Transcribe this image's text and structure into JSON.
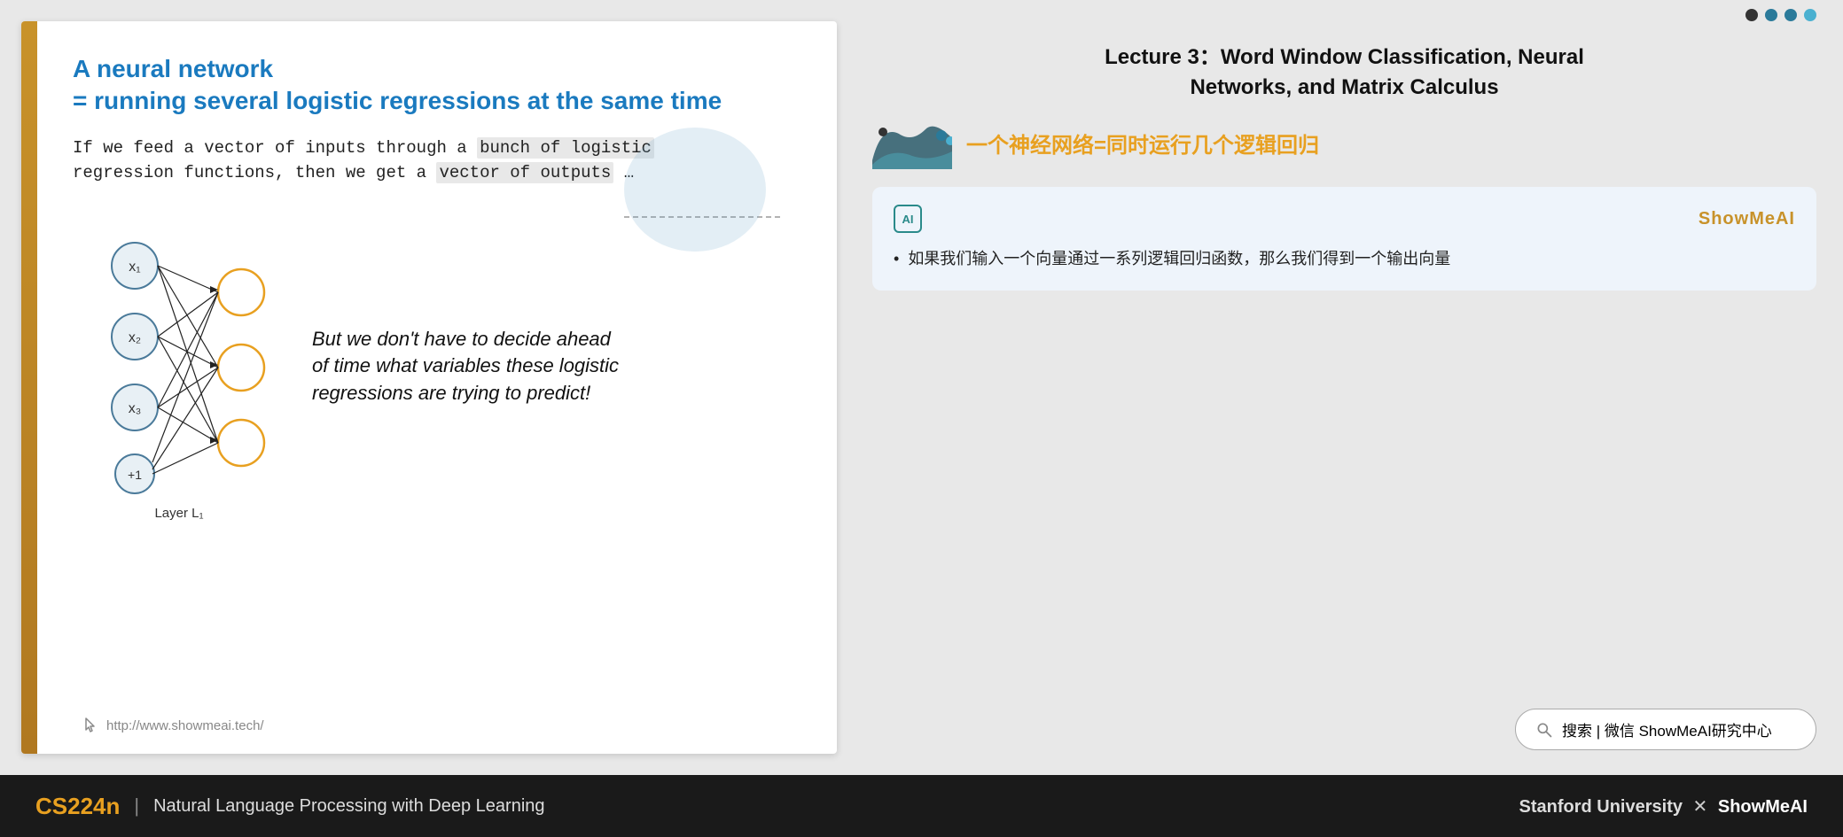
{
  "slide": {
    "title_line1": "A neural network",
    "title_line2": "= running several logistic regressions at the same time",
    "body_text": "If we feed a vector of inputs through a bunch of logistic regression functions, then we get a vector of outputs …",
    "italic_text": "But we don't have to decide ahead of time what variables these logistic regressions are trying to predict!",
    "layer_label": "Layer L₁",
    "url": "http://www.showmeai.tech/",
    "nodes_input": [
      "x₁",
      "x₂",
      "x₃",
      "+1"
    ]
  },
  "right": {
    "lecture_title_line1": "Lecture 3：Word Window Classification, Neural",
    "lecture_title_line2": "Networks, and Matrix Calculus",
    "chinese_title": "一个神经网络=同时运行几个逻辑回归",
    "card_brand": "ShowMeAI",
    "card_body_bullet": "如果我们输入一个向量通过一系列逻辑回归函数，那么我们得到一个输出向量",
    "search_placeholder": "搜索 | 微信 ShowMeAI研究中心"
  },
  "footer": {
    "course_code": "CS224n",
    "separator": "|",
    "course_name": "Natural Language Processing with Deep Learning",
    "university": "Stanford University",
    "cross": "✕",
    "brand": "ShowMeAI"
  },
  "dots": [
    {
      "color": "#333333"
    },
    {
      "color": "#2a7a9a"
    },
    {
      "color": "#2a7a9a"
    },
    {
      "color": "#4ab0d0"
    }
  ],
  "colors": {
    "accent_orange": "#e8a020",
    "accent_blue": "#1a7abf",
    "teal": "#2a8a8a",
    "dark_bg": "#1a1a1a"
  }
}
